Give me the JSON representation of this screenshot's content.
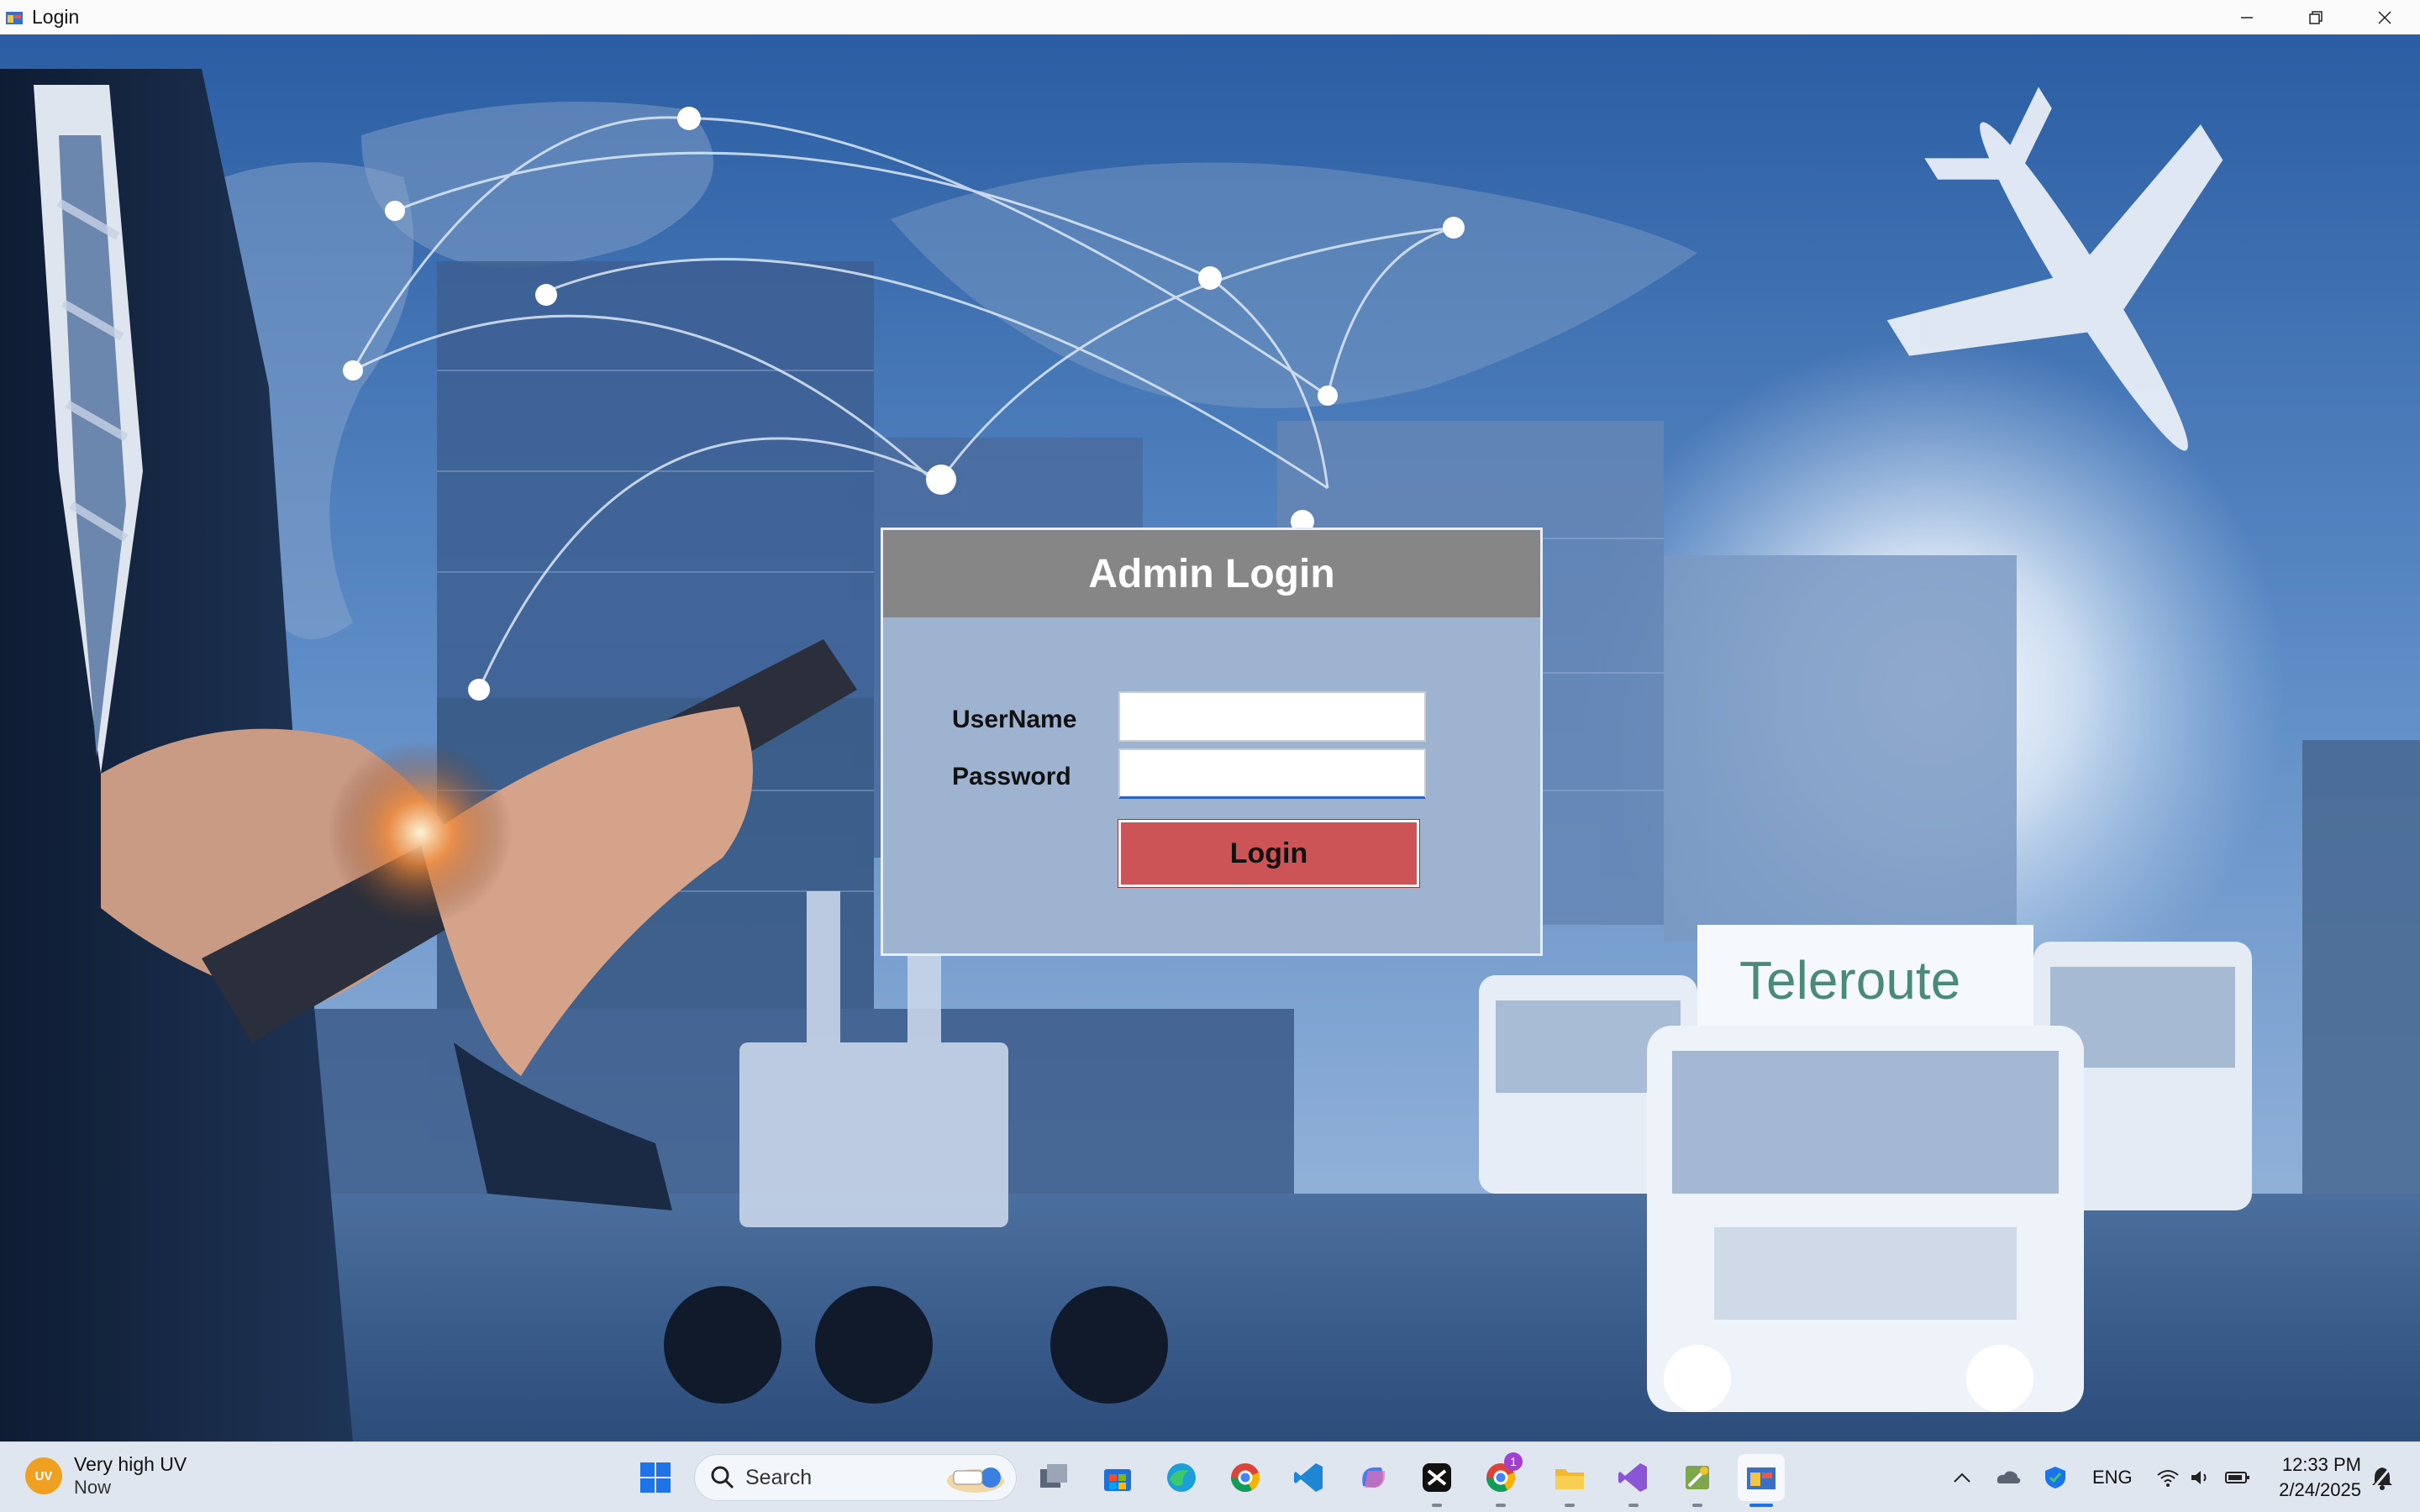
{
  "window": {
    "title": "Login"
  },
  "login": {
    "header": "Admin Login",
    "username_label": "UserName",
    "password_label": "Password",
    "username_value": "",
    "password_value": "",
    "button_label": "Login"
  },
  "scene": {
    "truck_brand": "Teleroute"
  },
  "taskbar": {
    "weather_badge": "UV",
    "weather_title": "Very high UV",
    "weather_sub": "Now",
    "search_label": "Search",
    "language": "ENG",
    "time": "12:33 PM",
    "date": "2/24/2025",
    "chrome_badge": "1"
  },
  "colors": {
    "panel_bg": "#9eb3cf",
    "header_bg": "#868686",
    "button_bg": "#cc5456",
    "accent": "#2a63c7"
  }
}
